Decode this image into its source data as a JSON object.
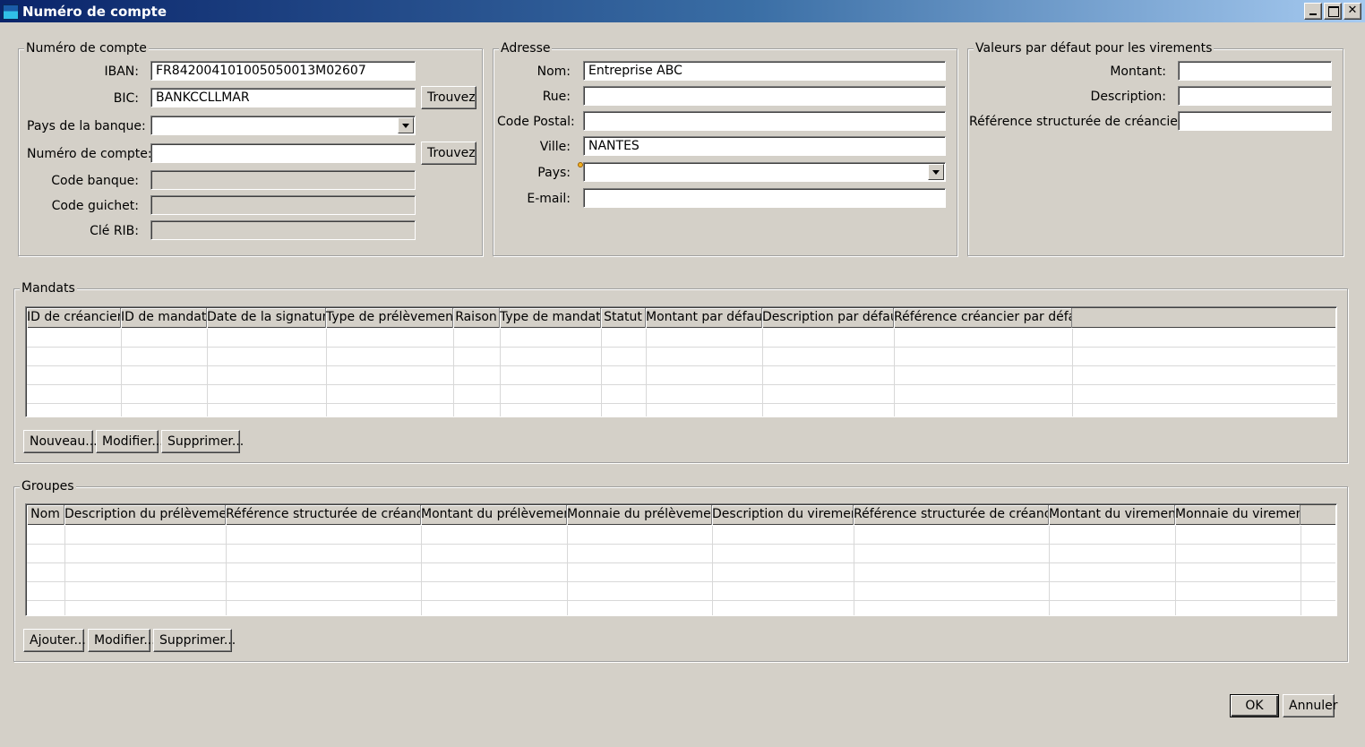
{
  "window": {
    "title": "Numéro de compte"
  },
  "account": {
    "legend": "Numéro de compte",
    "iban_label": "IBAN:",
    "iban_value": "FR842004101005050013M02607",
    "bic_label": "BIC:",
    "bic_value": "BANKCCLLMAR",
    "bic_find": "Trouvez",
    "bank_country_label": "Pays de la banque:",
    "bank_country_value": "",
    "account_number_label": "Numéro de compte:",
    "account_number_value": "",
    "account_find": "Trouvez",
    "bank_code_label": "Code banque:",
    "branch_code_label": "Code guichet:",
    "rib_key_label": "Clé RIB:"
  },
  "address": {
    "legend": "Adresse",
    "name_label": "Nom:",
    "name_value": "Entreprise ABC",
    "street_label": "Rue:",
    "street_value": "",
    "postal_label": "Code Postal:",
    "postal_value": "",
    "city_label": "Ville:",
    "city_value": "NANTES",
    "country_label": "Pays:",
    "country_value": "",
    "email_label": "E-mail:",
    "email_value": ""
  },
  "defaults": {
    "legend": "Valeurs par défaut pour les virements",
    "amount_label": "Montant:",
    "description_label": "Description:",
    "creditor_ref_label": "Référence structurée de créancier:"
  },
  "mandates": {
    "legend": "Mandats",
    "columns": [
      "ID de créancier",
      "ID de mandat",
      "Date de la signature",
      "Type de prélèvement",
      "Raison",
      "Type de mandat",
      "Statut",
      "Montant par défaut",
      "Description par défaut",
      "Référence créancier par défaut"
    ],
    "buttons": {
      "new": "Nouveau...",
      "edit": "Modifier...",
      "delete": "Supprimer..."
    }
  },
  "groups": {
    "legend": "Groupes",
    "columns": [
      "Nom",
      "Description du prélèvement",
      "Référence structurée de créancier",
      "Montant du prélèvement",
      "Monnaie du prélèvement",
      "Description du virement",
      "Référence structurée de créancier",
      "Montant du virement",
      "Monnaie du virement"
    ],
    "buttons": {
      "add": "Ajouter...",
      "edit": "Modifier...",
      "delete": "Supprimer..."
    }
  },
  "footer": {
    "ok": "OK",
    "cancel": "Annuler"
  }
}
